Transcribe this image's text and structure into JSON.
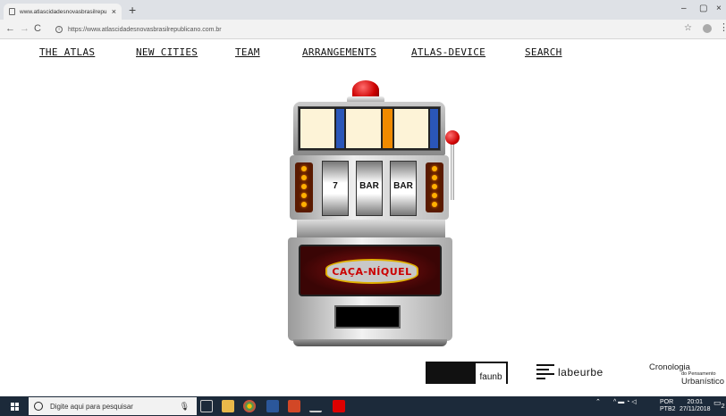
{
  "browser": {
    "tab_title": "www.atlascidadesnovasbrasilrepu",
    "tab_close": "×",
    "new_tab": "+",
    "url": "https://www.atlascidadesnovasbrasilrepublicano.com.br",
    "back": "←",
    "forward": "→",
    "reload": "C",
    "bookmark": "☆",
    "menu": "⋮",
    "minimize": "–",
    "maximize": "▢",
    "close": "×"
  },
  "nav": {
    "items": [
      {
        "label": "THE ATLAS"
      },
      {
        "label": "NEW CITIES"
      },
      {
        "label": "TEAM"
      },
      {
        "label": "ARRANGEMENTS"
      },
      {
        "label": "ATLAS-DEVICE"
      },
      {
        "label": "SEARCH"
      }
    ]
  },
  "hero": {
    "sign_text": "CAÇA-NÍQUEL",
    "reel_symbols": [
      "7",
      "BAR",
      "BAR"
    ]
  },
  "footer": {
    "faunb": "faunb",
    "labeurbe": "labeurbe",
    "cronologia": {
      "line1": "Cronologia",
      "line2": "do Pensamento",
      "line3": "Urbanístico"
    }
  },
  "taskbar": {
    "search_placeholder": "Digite aqui para pesquisar",
    "lang": "POR",
    "layout": "PTB2",
    "time": "20:01",
    "date": "27/11/2018",
    "notification_count": "2"
  },
  "colors": {
    "taskbar": "#1c2a3a",
    "accent_red": "#cc0000",
    "bulb": "#ffb000"
  }
}
